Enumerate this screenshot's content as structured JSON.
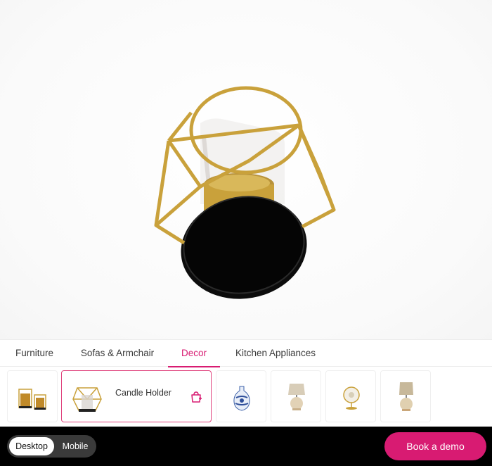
{
  "viewer": {
    "product_model": "candle-holder-3d-model"
  },
  "tabs": [
    {
      "label": "Furniture",
      "active": false
    },
    {
      "label": "Sofas & Armchair",
      "active": false
    },
    {
      "label": "Decor",
      "active": true
    },
    {
      "label": "Kitchen Appliances",
      "active": false
    }
  ],
  "products": {
    "selected_name": "Candle Holder",
    "items": [
      {
        "icon": "candle-set-icon"
      },
      {
        "icon": "candle-holder-icon"
      },
      {
        "icon": "vase-icon"
      },
      {
        "icon": "table-lamp-icon"
      },
      {
        "icon": "globe-icon"
      },
      {
        "icon": "lamp-icon"
      }
    ]
  },
  "footer": {
    "desktop_label": "Desktop",
    "mobile_label": "Mobile",
    "demo_label": "Book a demo"
  },
  "colors": {
    "accent": "#d81b72",
    "gold": "#c9a13b",
    "footer_bg": "#000000"
  }
}
